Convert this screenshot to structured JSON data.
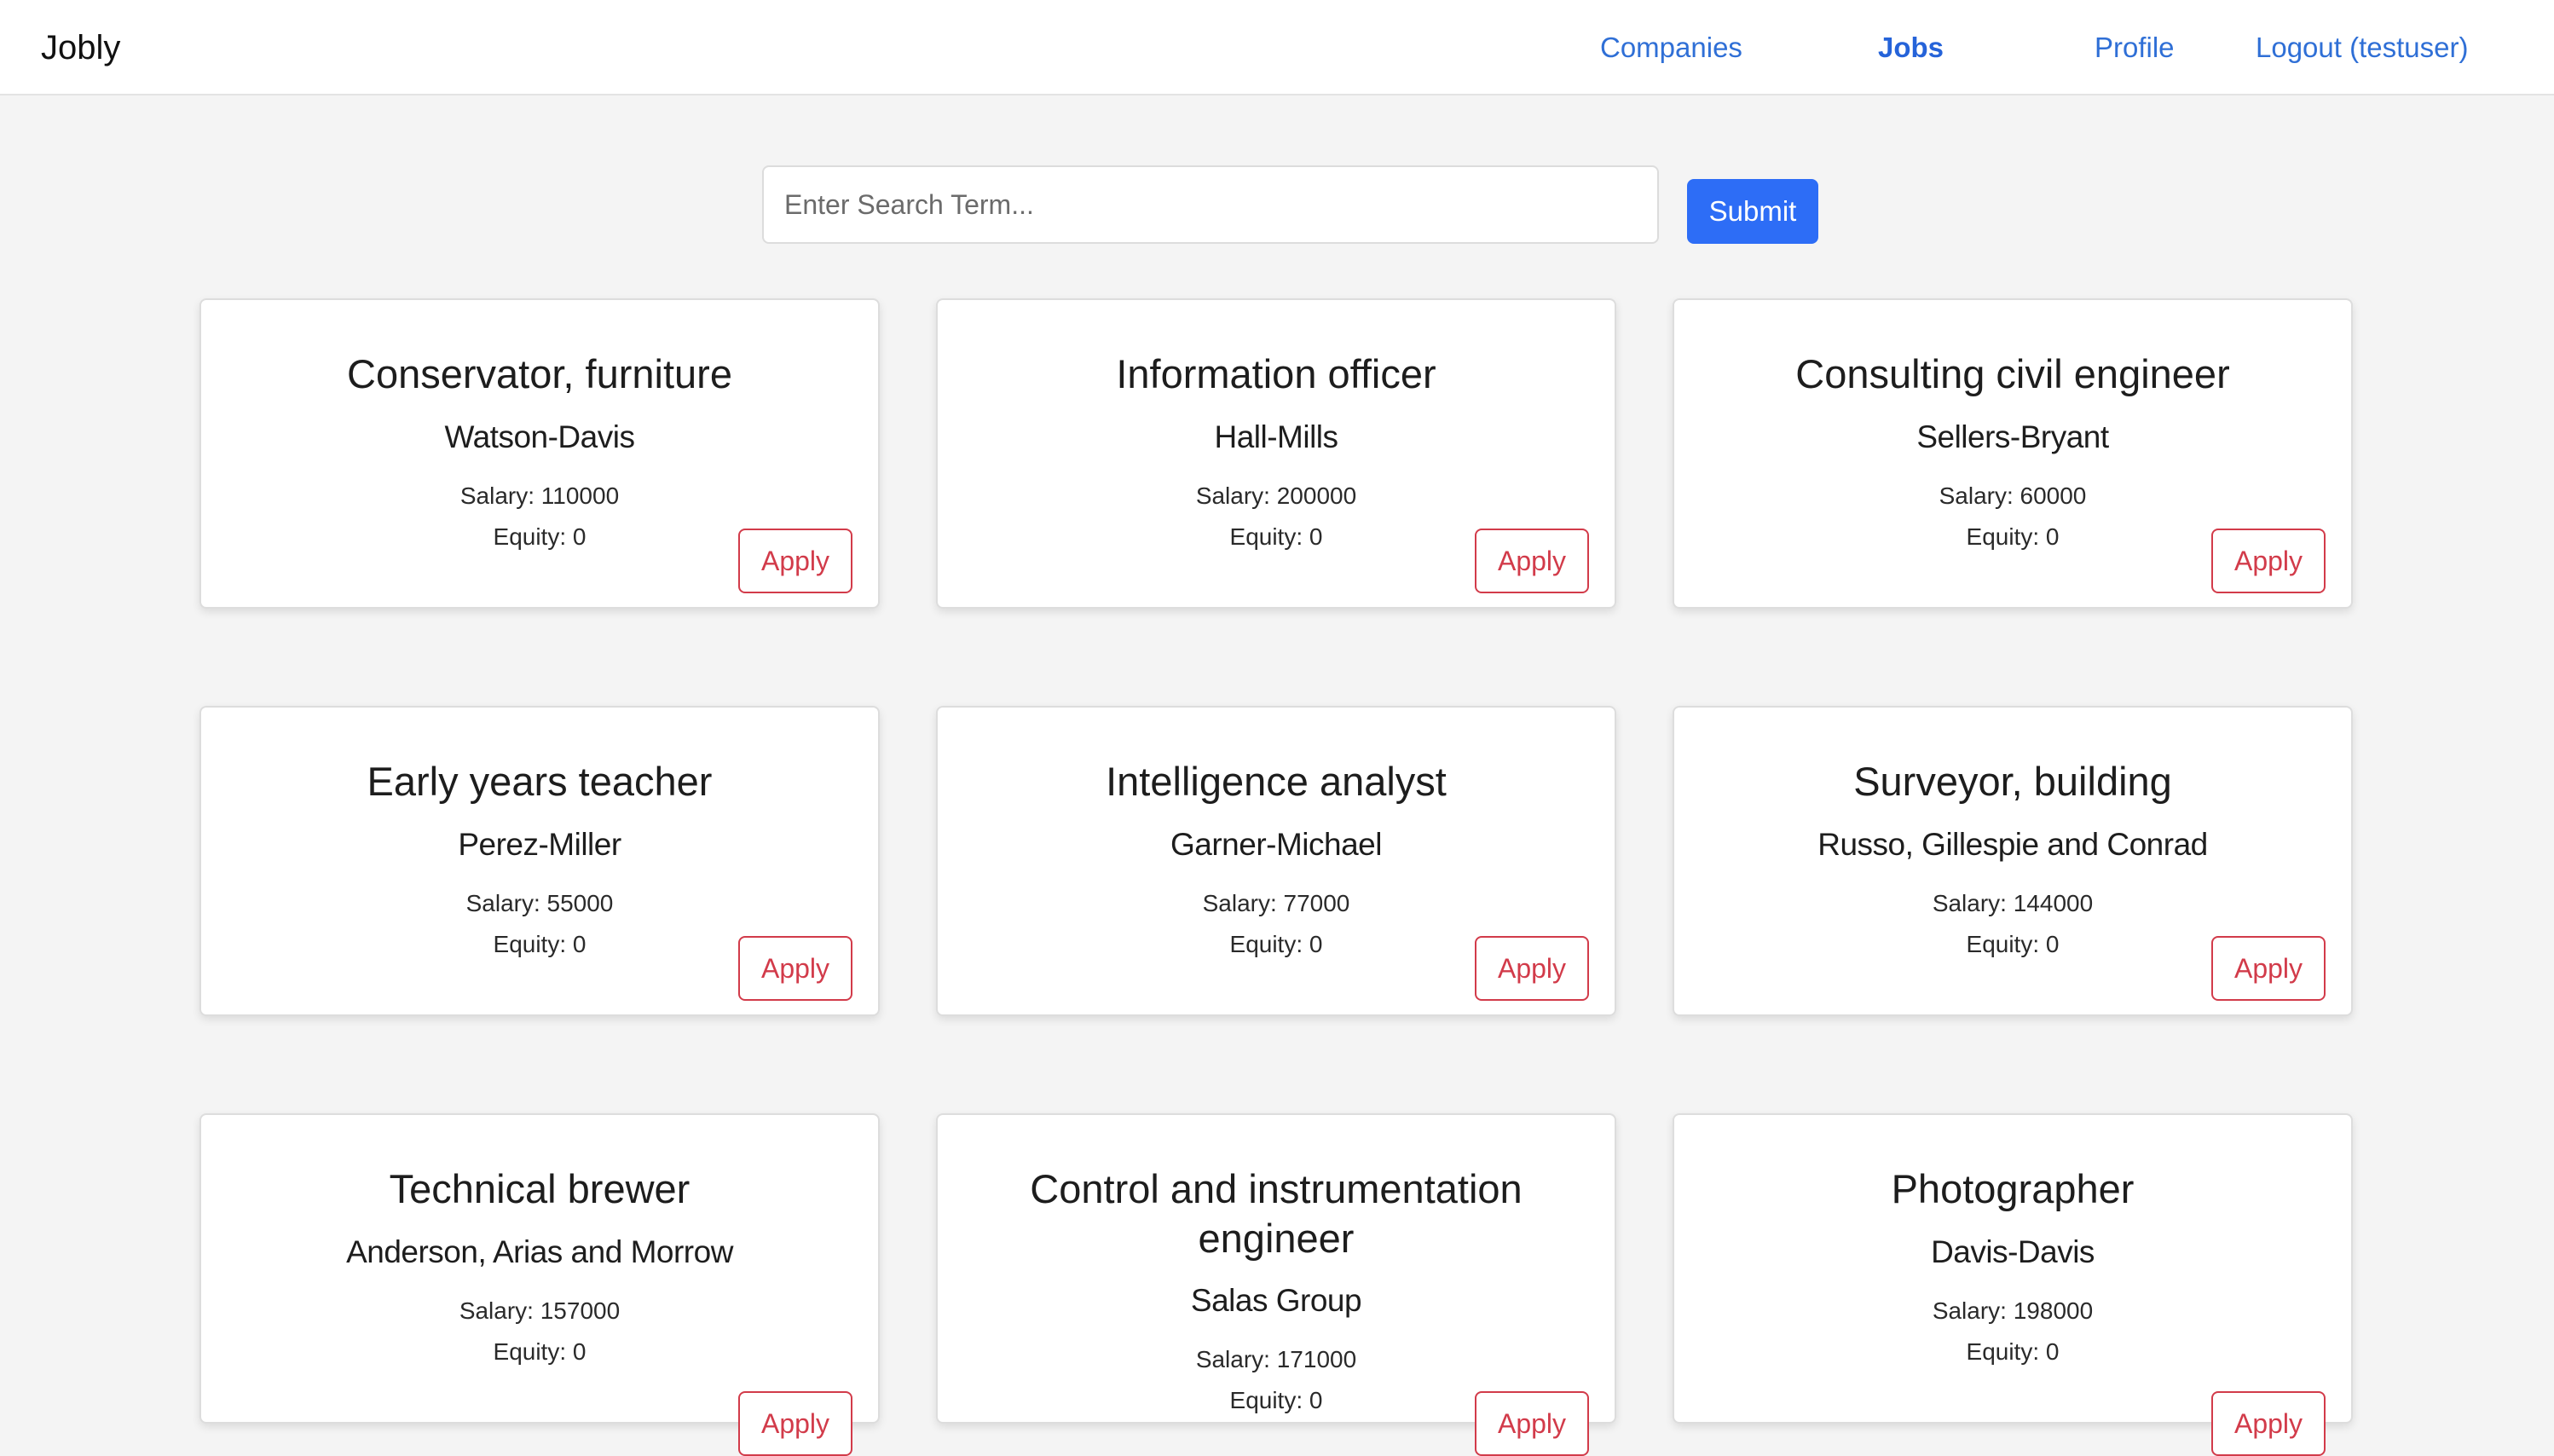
{
  "nav": {
    "brand": "Jobly",
    "links": [
      {
        "label": "Companies",
        "active": false
      },
      {
        "label": "Jobs",
        "active": true
      },
      {
        "label": "Profile",
        "active": false
      },
      {
        "label": "Logout (testuser)",
        "active": false
      }
    ]
  },
  "search": {
    "placeholder": "Enter Search Term...",
    "value": "",
    "submit_label": "Submit"
  },
  "jobs": [
    {
      "title": "Conservator, furniture",
      "company": "Watson-Davis",
      "salary": "Salary: 110000",
      "equity": "Equity: 0",
      "apply_label": "Apply"
    },
    {
      "title": "Information officer",
      "company": "Hall-Mills",
      "salary": "Salary: 200000",
      "equity": "Equity: 0",
      "apply_label": "Apply"
    },
    {
      "title": "Consulting civil engineer",
      "company": "Sellers-Bryant",
      "salary": "Salary: 60000",
      "equity": "Equity: 0",
      "apply_label": "Apply"
    },
    {
      "title": "Early years teacher",
      "company": "Perez-Miller",
      "salary": "Salary: 55000",
      "equity": "Equity: 0",
      "apply_label": "Apply"
    },
    {
      "title": "Intelligence analyst",
      "company": "Garner-Michael",
      "salary": "Salary: 77000",
      "equity": "Equity: 0",
      "apply_label": "Apply"
    },
    {
      "title": "Surveyor, building",
      "company": "Russo, Gillespie and Conrad",
      "salary": "Salary: 144000",
      "equity": "Equity: 0",
      "apply_label": "Apply"
    },
    {
      "title": "Technical brewer",
      "company": "Anderson, Arias and Morrow",
      "salary": "Salary: 157000",
      "equity": "Equity: 0",
      "apply_label": "Apply"
    },
    {
      "title": "Control and instrumentation engineer",
      "company": "Salas Group",
      "salary": "Salary: 171000",
      "equity": "Equity: 0",
      "apply_label": "Apply"
    },
    {
      "title": "Photographer",
      "company": "Davis-Davis",
      "salary": "Salary: 198000",
      "equity": "Equity: 0",
      "apply_label": "Apply"
    }
  ]
}
